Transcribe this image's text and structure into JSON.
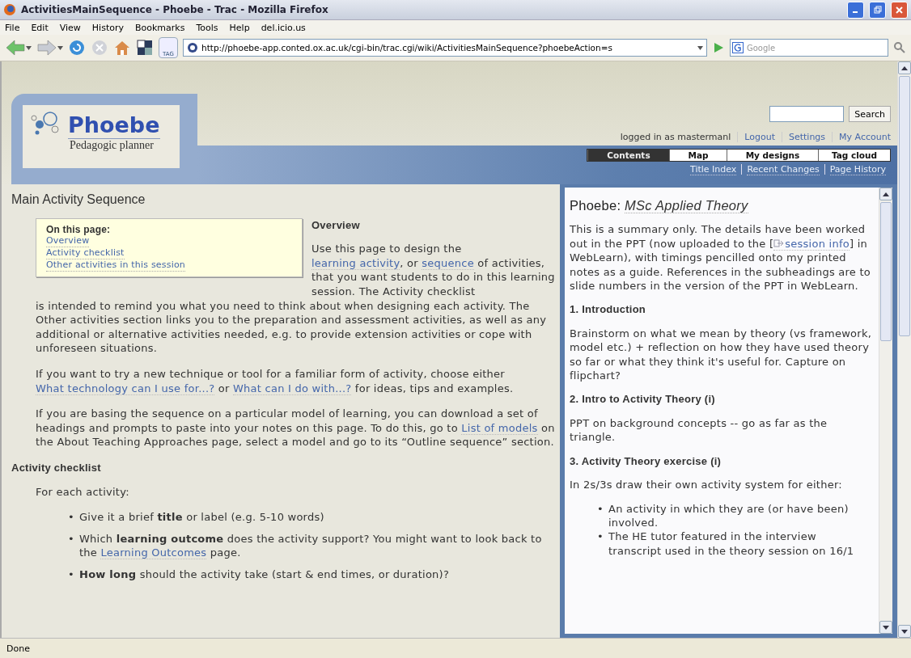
{
  "window": {
    "title": "ActivitiesMainSequence - Phoebe - Trac - Mozilla Firefox"
  },
  "menu": [
    "File",
    "Edit",
    "View",
    "History",
    "Bookmarks",
    "Tools",
    "Help",
    "del.icio.us"
  ],
  "toolbar": {
    "tag_label": "TAG",
    "url": "http://phoebe-app.conted.ox.ac.uk/cgi-bin/trac.cgi/wiki/ActivitiesMainSequence?phoebeAction=s",
    "search_placeholder": "Google"
  },
  "header": {
    "logo_title": "Phoebe",
    "logo_subtitle": "Pedagogic planner",
    "search_button": "Search",
    "login_text": "logged in as mastermanl",
    "user_links": [
      "Logout",
      "Settings",
      "My Account"
    ],
    "tabs": [
      {
        "label": "Contents",
        "selected": true
      },
      {
        "label": "Map",
        "selected": false
      },
      {
        "label": "My designs",
        "selected": false
      },
      {
        "label": "Tag cloud",
        "selected": false
      }
    ],
    "subnav": [
      "Title Index",
      "Recent Changes",
      "Page History"
    ]
  },
  "main": {
    "heading": "Main Activity Sequence",
    "toc": {
      "title": "On this page:",
      "items": [
        "Overview",
        "Activity checklist",
        "Other activities in this session"
      ]
    },
    "overview_heading": "Overview",
    "overview_lead": [
      {
        "kind": "text",
        "text": "Use this page to design the "
      },
      {
        "kind": "link",
        "text": "learning activity"
      },
      {
        "kind": "text",
        "text": ", or "
      },
      {
        "kind": "link",
        "text": "sequence"
      },
      {
        "kind": "text",
        "text": " of activities, that you want students to do in this learning session. The Activity checklist"
      }
    ],
    "paragraphs": [
      [
        {
          "kind": "text",
          "text": "is intended to remind you what you need to think about when designing each activity. The Other activities section links you to the preparation and assessment activities, as well as any additional or alternative activities needed, e.g. to provide extension activities or cope with unforeseen situations."
        }
      ],
      [
        {
          "kind": "text",
          "text": "If you want to try a new technique or tool for a familiar form of activity, choose either "
        },
        {
          "kind": "link",
          "text": "What technology can I use for...?"
        },
        {
          "kind": "text",
          "text": " or "
        },
        {
          "kind": "link",
          "text": "What can I do with...?"
        },
        {
          "kind": "text",
          "text": " for ideas, tips and examples."
        }
      ],
      [
        {
          "kind": "text",
          "text": "If you are basing the sequence on a particular model of learning, you can download a set of headings and prompts to paste into your notes on this page. To do this, go to "
        },
        {
          "kind": "link",
          "text": "List of models"
        },
        {
          "kind": "text",
          "text": " on the About Teaching Approaches page, select a model and go to its “Outline sequence” section."
        }
      ]
    ],
    "checklist_heading": "Activity checklist",
    "checklist_intro": "For each activity:",
    "bullet_mark": "•",
    "bullets": [
      [
        {
          "kind": "text",
          "text": "Give it a brief "
        },
        {
          "kind": "bold",
          "text": "title"
        },
        {
          "kind": "text",
          "text": " or label (e.g. 5-10 words)"
        }
      ],
      [
        {
          "kind": "text",
          "text": "Which "
        },
        {
          "kind": "bold",
          "text": "learning outcome"
        },
        {
          "kind": "text",
          "text": " does the activity support? You might want to look back to the "
        },
        {
          "kind": "link",
          "text": "Learning Outcomes"
        },
        {
          "kind": "text",
          "text": " page."
        }
      ],
      [
        {
          "kind": "bold",
          "text": "How long"
        },
        {
          "kind": "text",
          "text": " should the activity take (start & end times, or duration)?"
        }
      ]
    ]
  },
  "sidebar": {
    "title_prefix": "Phoebe:",
    "title_link": "MSc Applied Theory",
    "intro": [
      {
        "kind": "text",
        "text": "This is a summary only. The details have been worked out in the PPT (now uploaded to the ["
      },
      {
        "kind": "external",
        "text": "session info"
      },
      {
        "kind": "text",
        "text": "] in WebLearn), with timings pencilled onto my printed notes as a guide. References in the subheadings are to slide numbers in the version of the PPT in WebLearn."
      }
    ],
    "bullet_mark": "•",
    "sections": [
      {
        "heading": "1. Introduction",
        "text": "Brainstorm on what we mean by theory (vs framework, model etc.) + reflection on how they have used theory so far or what they think it's useful for. Capture on flipchart?"
      },
      {
        "heading": "2. Intro to Activity Theory (i)",
        "text": "PPT on background concepts -- go as far as the triangle."
      },
      {
        "heading": "3. Activity Theory exercise (i)",
        "text": "In 2s/3s draw their own activity system for either:",
        "bullets": [
          "An activity in which they are (or have been) involved.",
          "The HE tutor featured in the interview transcript used in the theory session on 16/1"
        ]
      }
    ]
  },
  "status_bar": "Done"
}
